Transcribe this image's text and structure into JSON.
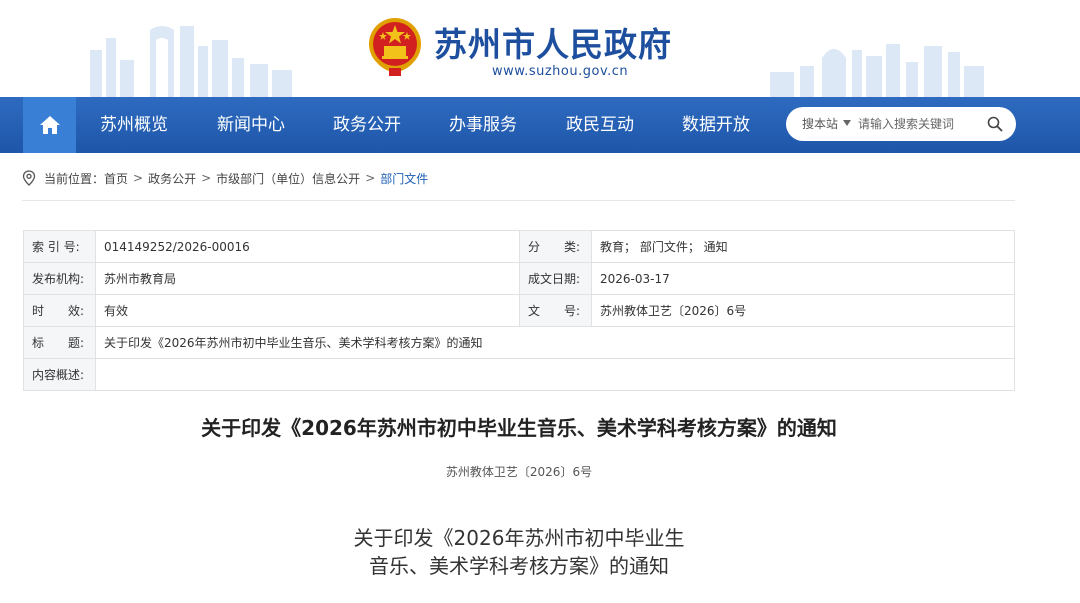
{
  "header": {
    "site_title": "苏州市人民政府",
    "site_url": "www.suzhou.gov.cn",
    "brand_color": "#1d4f9e"
  },
  "nav": {
    "home_icon": "home-icon",
    "items": [
      {
        "label": "苏州概览"
      },
      {
        "label": "新闻中心"
      },
      {
        "label": "政务公开"
      },
      {
        "label": "办事服务"
      },
      {
        "label": "政民互动"
      },
      {
        "label": "数据开放"
      }
    ],
    "bar_color": "#2160b3"
  },
  "search": {
    "scope_label": "搜本站",
    "placeholder": "请输入搜索关键词",
    "icon": "search-icon"
  },
  "breadcrumb": {
    "prefix": "当前位置：",
    "items": [
      {
        "label": "首页"
      },
      {
        "label": "政务公开"
      },
      {
        "label": "市级部门（单位）信息公开"
      },
      {
        "label": "部门文件"
      }
    ],
    "separator": ">"
  },
  "info": {
    "index_label": "索 引 号:",
    "index_value": "014149252/2026-00016",
    "category_label": "分　　类:",
    "category_value": "教育；  部门文件；  通知",
    "publisher_label": "发布机构:",
    "publisher_value": "苏州市教育局",
    "date_label": "成文日期:",
    "date_value": "2026-03-17",
    "validity_label": "时　　效:",
    "validity_value": "有效",
    "docno_label": "文　　号:",
    "docno_value": "苏州教体卫艺〔2026〕6号",
    "title_label": "标　　题:",
    "title_value": "关于印发《2026年苏州市初中毕业生音乐、美术学科考核方案》的通知",
    "summary_label": "内容概述:",
    "summary_value": ""
  },
  "article": {
    "title": "关于印发《2026年苏州市初中毕业生音乐、美术学科考核方案》的通知",
    "doc_number": "苏州教体卫艺〔2026〕6号",
    "body_title_line1": "关于印发《2026年苏州市初中毕业生",
    "body_title_line2": "音乐、美术学科考核方案》的通知"
  }
}
